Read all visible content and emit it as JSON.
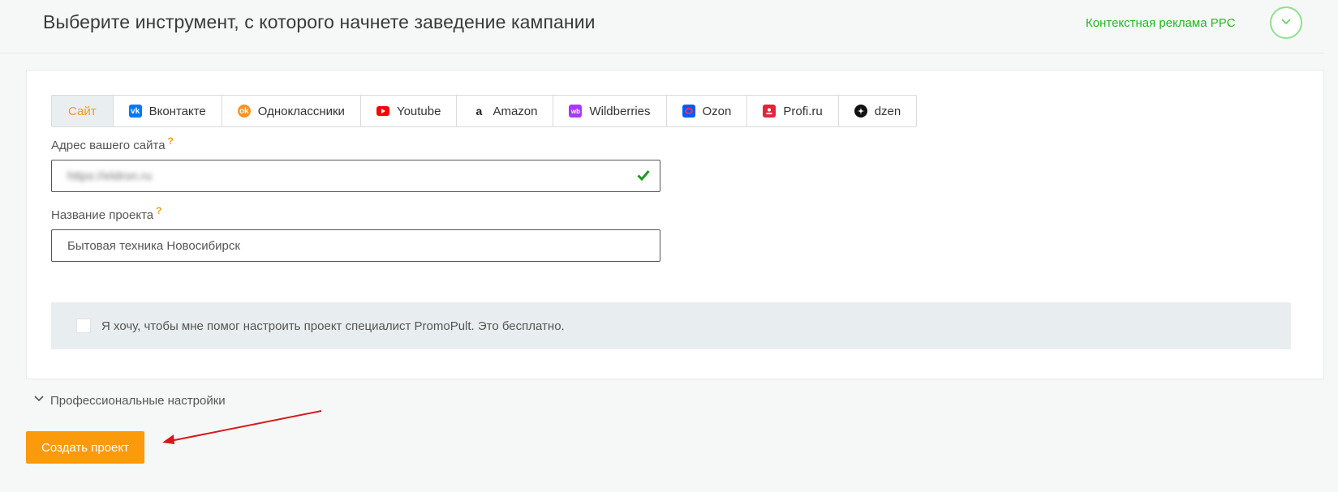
{
  "header": {
    "title": "Выберите инструмент, с которого начнете заведение кампании",
    "mode_label": "Контекстная реклама PPC"
  },
  "tabs": [
    {
      "label": "Сайт",
      "icon": "",
      "active": true
    },
    {
      "label": "Вконтакте",
      "icon": "vk-icon",
      "color": "#0077ff"
    },
    {
      "label": "Одноклассники",
      "icon": "ok-icon",
      "color": "#f7931e"
    },
    {
      "label": "Youtube",
      "icon": "youtube-icon",
      "color": "#ff0000"
    },
    {
      "label": "Amazon",
      "icon": "amazon-icon",
      "color": "#222222"
    },
    {
      "label": "Wildberries",
      "icon": "wildberries-icon",
      "color": "#a73afd"
    },
    {
      "label": "Ozon",
      "icon": "ozon-icon",
      "color": "#005bff"
    },
    {
      "label": "Profi.ru",
      "icon": "profi-icon",
      "color": "#e0263a"
    },
    {
      "label": "dzen",
      "icon": "dzen-icon",
      "color": "#111111"
    }
  ],
  "site_field": {
    "label": "Адрес вашего сайта",
    "hint": "?",
    "value": "https://eldron.ru"
  },
  "project_field": {
    "label": "Название проекта",
    "hint": "?",
    "value": "Бытовая техника Новосибирск"
  },
  "consult": {
    "text": "Я хочу, чтобы мне помог настроить проект специалист PromoPult. Это бесплатно.",
    "checked": false
  },
  "pro_settings_label": "Профессиональные настройки",
  "create_button_label": "Создать проект",
  "colors": {
    "accent_orange": "#fb9a0a",
    "accent_green": "#21b821",
    "annotation_red": "#d81818"
  }
}
